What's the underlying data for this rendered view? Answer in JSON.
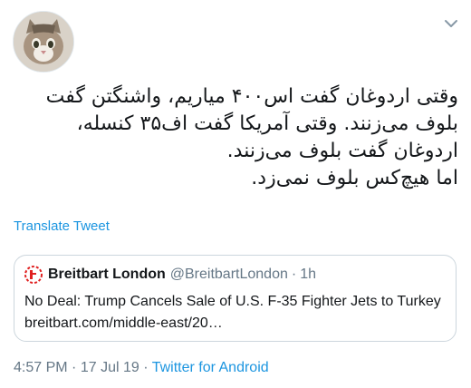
{
  "tweet": {
    "lines": [
      "وقتی اردوغان گفت اس۴۰۰ میاریم، واشنگتن گفت",
      "بلوف می‌زنند. وقتی آمریکا گفت اف۳۵ کنسله،",
      "اردوغان گفت بلوف می‌زنند.",
      "اما هیچ‌کس بلوف نمی‌زد."
    ],
    "translate_label": "Translate Tweet"
  },
  "quote": {
    "name": "Breitbart London",
    "handle": "@BreitbartLondon",
    "separator": "·",
    "time": "1h",
    "text": "No Deal: Trump Cancels Sale of U.S. F-35 Fighter Jets to Turkey",
    "link": "breitbart.com/middle-east/20…"
  },
  "meta": {
    "time": "4:57 PM",
    "sep1": "·",
    "date": "17 Jul 19",
    "sep2": "·",
    "source": "Twitter for Android"
  },
  "colors": {
    "link": "#1b95e0",
    "muted": "#657786",
    "border": "#ccd6dd",
    "breitbart_red": "#e02020"
  },
  "icons": {
    "avatar": "cat-avatar",
    "menu": "chevron-down-icon",
    "quote_logo": "breitbart-logo-icon"
  }
}
